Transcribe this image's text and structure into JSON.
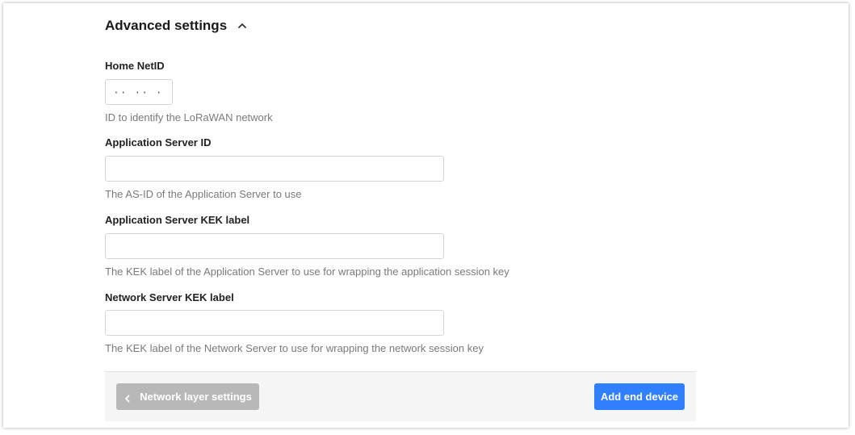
{
  "section": {
    "title": "Advanced settings",
    "toggle_icon": "chevron-up-icon"
  },
  "fields": {
    "home_netid": {
      "label": "Home NetID",
      "value": "·· ·· ··",
      "description": "ID to identify the LoRaWAN network"
    },
    "as_id": {
      "label": "Application Server ID",
      "value": "",
      "description": "The AS-ID of the Application Server to use"
    },
    "as_kek_label": {
      "label": "Application Server KEK label",
      "value": "",
      "description": "The KEK label of the Application Server to use for wrapping the application session key"
    },
    "ns_kek_label": {
      "label": "Network Server KEK label",
      "value": "",
      "description": "The KEK label of the Network Server to use for wrapping the network session key"
    }
  },
  "footer": {
    "back_label": "Network layer settings",
    "back_icon": "chevron-left-icon",
    "submit_label": "Add end device"
  },
  "colors": {
    "primary": "#2f7fff",
    "disabled_button": "#b8b8b8"
  }
}
